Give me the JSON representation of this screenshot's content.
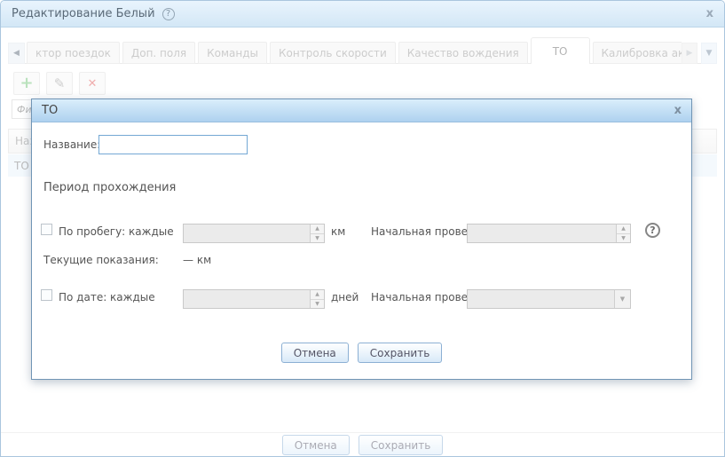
{
  "window": {
    "title": "Редактирование Белый"
  },
  "icons": {
    "help": "?",
    "close": "x",
    "add": "+",
    "edit": "✎",
    "delete": "✕",
    "scroll_left": "◀",
    "scroll_right": "▶",
    "dropdown": "▼",
    "spin_up": "▲",
    "spin_down": "▼"
  },
  "tabs": {
    "items": [
      {
        "label": "ктор поездок",
        "active": false
      },
      {
        "label": "Доп. поля",
        "active": false
      },
      {
        "label": "Команды",
        "active": false
      },
      {
        "label": "Контроль скорости",
        "active": false
      },
      {
        "label": "Качество вождения",
        "active": false
      },
      {
        "label": "ТО",
        "active": true
      },
      {
        "label": "Калибровка акселерометра",
        "active": false
      }
    ]
  },
  "filter": {
    "placeholder": "Фильтр"
  },
  "table": {
    "header": "Название",
    "rows": [
      "ТО"
    ]
  },
  "footer": {
    "cancel_label": "Отмена",
    "save_label": "Сохранить"
  },
  "dialog": {
    "title": "ТО",
    "name_label": "Название:",
    "name_value": "",
    "section_title": "Период прохождения",
    "mileage": {
      "checkbox_label": "По пробегу: каждые",
      "value": "",
      "checked": false,
      "unit": "км",
      "initial_label": "Начальная проверка:",
      "initial_value": ""
    },
    "current_label": "Текущие показания:",
    "current_value": "— км",
    "date": {
      "checkbox_label": "По дате: каждые",
      "value": "",
      "checked": false,
      "unit": "дней",
      "initial_label": "Начальная проверка:",
      "initial_value": ""
    },
    "cancel_label": "Отмена",
    "save_label": "Сохранить"
  },
  "colors": {
    "header_blue_top": "#e9f4fd",
    "header_blue_bottom": "#d3e7f6",
    "modal_header_top": "#daeefb",
    "modal_header_bottom": "#aed1ef",
    "modal_border": "#7195b5",
    "button_border": "#8cb0d4",
    "add_green": "#74c47a",
    "delete_red": "#e05c5c",
    "selected_row": "#e9f3fb"
  }
}
